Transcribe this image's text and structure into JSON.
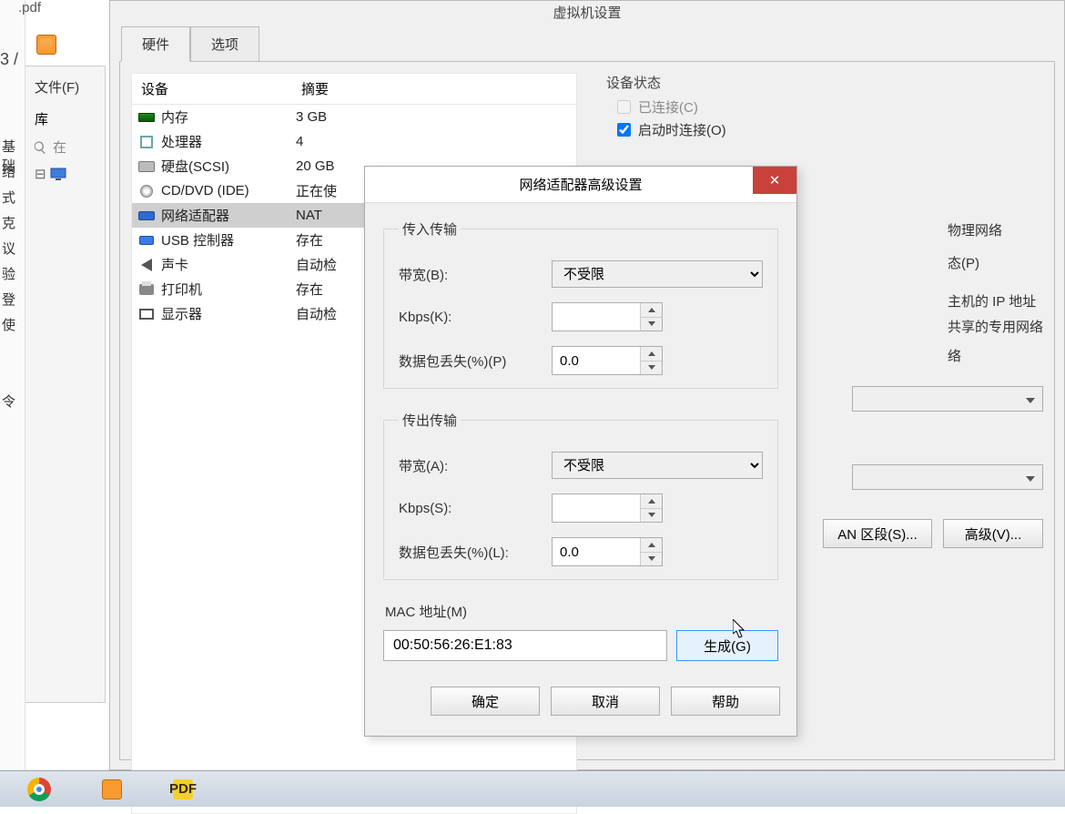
{
  "bg": {
    "pdf_ext": ".pdf",
    "slash": "3 /",
    "file_menu": "文件(F)",
    "library": "库",
    "search_placeholder": "在",
    "left_words": [
      "基础",
      "络",
      "式",
      "克",
      "议",
      "验",
      "登",
      "使",
      "",
      "",
      "令"
    ]
  },
  "vm_window": {
    "title": "虚拟机设置",
    "tabs": {
      "hardware": "硬件",
      "options": "选项"
    },
    "head_device": "设备",
    "head_summary": "摘要",
    "devices": [
      {
        "label": "内存",
        "summary": "3 GB",
        "icon": "mem"
      },
      {
        "label": "处理器",
        "summary": "4",
        "icon": "cpu"
      },
      {
        "label": "硬盘(SCSI)",
        "summary": "20 GB",
        "icon": "hdd"
      },
      {
        "label": "CD/DVD (IDE)",
        "summary": "正在使",
        "icon": "cd"
      },
      {
        "label": "网络适配器",
        "summary": "NAT",
        "icon": "net"
      },
      {
        "label": "USB 控制器",
        "summary": "存在",
        "icon": "usb"
      },
      {
        "label": "声卡",
        "summary": "自动检",
        "icon": "snd"
      },
      {
        "label": "打印机",
        "summary": "存在",
        "icon": "prn"
      },
      {
        "label": "显示器",
        "summary": "自动检",
        "icon": "disp"
      }
    ],
    "right": {
      "device_state": "设备状态",
      "connected": "已连接(C)",
      "connect_on_power": "启动时连接(O)",
      "ghost1": "物理网络",
      "ghost2": "态(P)",
      "ghost3": "主机的 IP 地址",
      "ghost4": "共享的专用网络",
      "ghost5": "络",
      "lan_btn": "AN 区段(S)...",
      "adv_btn": "高级(V)..."
    }
  },
  "dialog": {
    "title": "网络适配器高级设置",
    "close": "✕",
    "incoming": "传入传输",
    "outgoing": "传出传输",
    "bw_b": "带宽(B):",
    "bw_a": "带宽(A):",
    "bw_unlimited": "不受限",
    "kbps_k": "Kbps(K):",
    "kbps_s": "Kbps(S):",
    "loss_p": "数据包丢失(%)(P)",
    "loss_l": "数据包丢失(%)(L):",
    "loss_val": "0.0",
    "kbps_val": "",
    "mac_lbl": "MAC 地址(M)",
    "mac_val": "00:50:56:26:E1:83",
    "generate": "生成(G)",
    "ok": "确定",
    "cancel": "取消",
    "help": "帮助"
  },
  "taskbar": {
    "pdf": "PDF"
  }
}
